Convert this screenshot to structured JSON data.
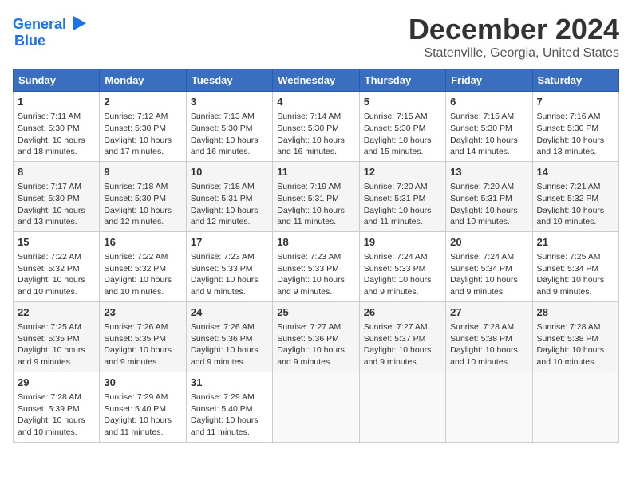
{
  "logo": {
    "line1": "General",
    "line2": "Blue"
  },
  "title": "December 2024",
  "subtitle": "Statenville, Georgia, United States",
  "weekdays": [
    "Sunday",
    "Monday",
    "Tuesday",
    "Wednesday",
    "Thursday",
    "Friday",
    "Saturday"
  ],
  "weeks": [
    [
      {
        "day": "1",
        "lines": [
          "Sunrise: 7:11 AM",
          "Sunset: 5:30 PM",
          "Daylight: 10 hours",
          "and 18 minutes."
        ]
      },
      {
        "day": "2",
        "lines": [
          "Sunrise: 7:12 AM",
          "Sunset: 5:30 PM",
          "Daylight: 10 hours",
          "and 17 minutes."
        ]
      },
      {
        "day": "3",
        "lines": [
          "Sunrise: 7:13 AM",
          "Sunset: 5:30 PM",
          "Daylight: 10 hours",
          "and 16 minutes."
        ]
      },
      {
        "day": "4",
        "lines": [
          "Sunrise: 7:14 AM",
          "Sunset: 5:30 PM",
          "Daylight: 10 hours",
          "and 16 minutes."
        ]
      },
      {
        "day": "5",
        "lines": [
          "Sunrise: 7:15 AM",
          "Sunset: 5:30 PM",
          "Daylight: 10 hours",
          "and 15 minutes."
        ]
      },
      {
        "day": "6",
        "lines": [
          "Sunrise: 7:15 AM",
          "Sunset: 5:30 PM",
          "Daylight: 10 hours",
          "and 14 minutes."
        ]
      },
      {
        "day": "7",
        "lines": [
          "Sunrise: 7:16 AM",
          "Sunset: 5:30 PM",
          "Daylight: 10 hours",
          "and 13 minutes."
        ]
      }
    ],
    [
      {
        "day": "8",
        "lines": [
          "Sunrise: 7:17 AM",
          "Sunset: 5:30 PM",
          "Daylight: 10 hours",
          "and 13 minutes."
        ]
      },
      {
        "day": "9",
        "lines": [
          "Sunrise: 7:18 AM",
          "Sunset: 5:30 PM",
          "Daylight: 10 hours",
          "and 12 minutes."
        ]
      },
      {
        "day": "10",
        "lines": [
          "Sunrise: 7:18 AM",
          "Sunset: 5:31 PM",
          "Daylight: 10 hours",
          "and 12 minutes."
        ]
      },
      {
        "day": "11",
        "lines": [
          "Sunrise: 7:19 AM",
          "Sunset: 5:31 PM",
          "Daylight: 10 hours",
          "and 11 minutes."
        ]
      },
      {
        "day": "12",
        "lines": [
          "Sunrise: 7:20 AM",
          "Sunset: 5:31 PM",
          "Daylight: 10 hours",
          "and 11 minutes."
        ]
      },
      {
        "day": "13",
        "lines": [
          "Sunrise: 7:20 AM",
          "Sunset: 5:31 PM",
          "Daylight: 10 hours",
          "and 10 minutes."
        ]
      },
      {
        "day": "14",
        "lines": [
          "Sunrise: 7:21 AM",
          "Sunset: 5:32 PM",
          "Daylight: 10 hours",
          "and 10 minutes."
        ]
      }
    ],
    [
      {
        "day": "15",
        "lines": [
          "Sunrise: 7:22 AM",
          "Sunset: 5:32 PM",
          "Daylight: 10 hours",
          "and 10 minutes."
        ]
      },
      {
        "day": "16",
        "lines": [
          "Sunrise: 7:22 AM",
          "Sunset: 5:32 PM",
          "Daylight: 10 hours",
          "and 10 minutes."
        ]
      },
      {
        "day": "17",
        "lines": [
          "Sunrise: 7:23 AM",
          "Sunset: 5:33 PM",
          "Daylight: 10 hours",
          "and 9 minutes."
        ]
      },
      {
        "day": "18",
        "lines": [
          "Sunrise: 7:23 AM",
          "Sunset: 5:33 PM",
          "Daylight: 10 hours",
          "and 9 minutes."
        ]
      },
      {
        "day": "19",
        "lines": [
          "Sunrise: 7:24 AM",
          "Sunset: 5:33 PM",
          "Daylight: 10 hours",
          "and 9 minutes."
        ]
      },
      {
        "day": "20",
        "lines": [
          "Sunrise: 7:24 AM",
          "Sunset: 5:34 PM",
          "Daylight: 10 hours",
          "and 9 minutes."
        ]
      },
      {
        "day": "21",
        "lines": [
          "Sunrise: 7:25 AM",
          "Sunset: 5:34 PM",
          "Daylight: 10 hours",
          "and 9 minutes."
        ]
      }
    ],
    [
      {
        "day": "22",
        "lines": [
          "Sunrise: 7:25 AM",
          "Sunset: 5:35 PM",
          "Daylight: 10 hours",
          "and 9 minutes."
        ]
      },
      {
        "day": "23",
        "lines": [
          "Sunrise: 7:26 AM",
          "Sunset: 5:35 PM",
          "Daylight: 10 hours",
          "and 9 minutes."
        ]
      },
      {
        "day": "24",
        "lines": [
          "Sunrise: 7:26 AM",
          "Sunset: 5:36 PM",
          "Daylight: 10 hours",
          "and 9 minutes."
        ]
      },
      {
        "day": "25",
        "lines": [
          "Sunrise: 7:27 AM",
          "Sunset: 5:36 PM",
          "Daylight: 10 hours",
          "and 9 minutes."
        ]
      },
      {
        "day": "26",
        "lines": [
          "Sunrise: 7:27 AM",
          "Sunset: 5:37 PM",
          "Daylight: 10 hours",
          "and 9 minutes."
        ]
      },
      {
        "day": "27",
        "lines": [
          "Sunrise: 7:28 AM",
          "Sunset: 5:38 PM",
          "Daylight: 10 hours",
          "and 10 minutes."
        ]
      },
      {
        "day": "28",
        "lines": [
          "Sunrise: 7:28 AM",
          "Sunset: 5:38 PM",
          "Daylight: 10 hours",
          "and 10 minutes."
        ]
      }
    ],
    [
      {
        "day": "29",
        "lines": [
          "Sunrise: 7:28 AM",
          "Sunset: 5:39 PM",
          "Daylight: 10 hours",
          "and 10 minutes."
        ]
      },
      {
        "day": "30",
        "lines": [
          "Sunrise: 7:29 AM",
          "Sunset: 5:40 PM",
          "Daylight: 10 hours",
          "and 11 minutes."
        ]
      },
      {
        "day": "31",
        "lines": [
          "Sunrise: 7:29 AM",
          "Sunset: 5:40 PM",
          "Daylight: 10 hours",
          "and 11 minutes."
        ]
      },
      null,
      null,
      null,
      null
    ]
  ]
}
